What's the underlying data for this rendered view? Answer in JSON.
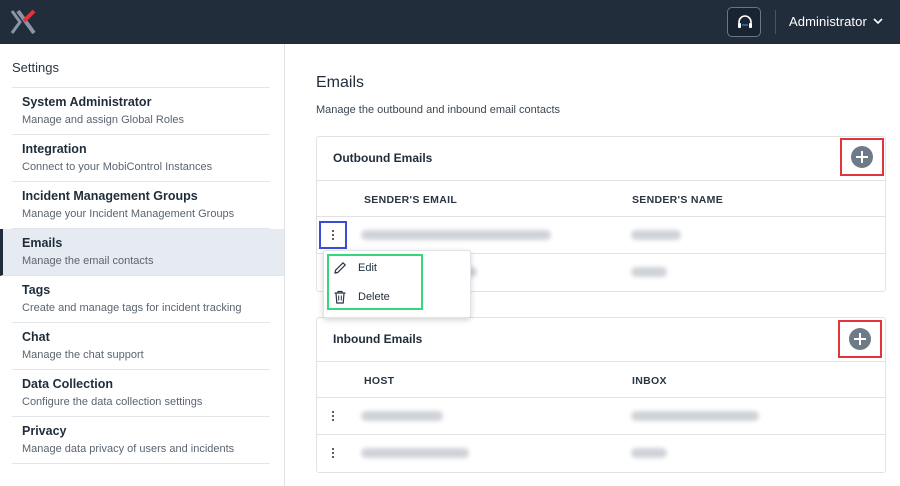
{
  "topbar": {
    "logo_icon": "brand-x-logo",
    "help_icon": "headset-icon",
    "user_label": "Administrator",
    "user_menu_icon": "chevron-down-icon"
  },
  "sidebar": {
    "title": "Settings",
    "items": [
      {
        "label": "System Administrator",
        "description": "Manage and assign Global Roles",
        "active": false
      },
      {
        "label": "Integration",
        "description": "Connect to your MobiControl Instances",
        "active": false
      },
      {
        "label": "Incident Management Groups",
        "description": "Manage your Incident Management Groups",
        "active": false
      },
      {
        "label": "Emails",
        "description": "Manage the email contacts",
        "active": true
      },
      {
        "label": "Tags",
        "description": "Create and manage tags for incident tracking",
        "active": false
      },
      {
        "label": "Chat",
        "description": "Manage the chat support",
        "active": false
      },
      {
        "label": "Data Collection",
        "description": "Configure the data collection settings",
        "active": false
      },
      {
        "label": "Privacy",
        "description": "Manage data privacy of users and incidents",
        "active": false
      }
    ]
  },
  "main": {
    "title": "Emails",
    "description": "Manage the outbound and inbound email contacts",
    "outbound": {
      "title": "Outbound Emails",
      "add_icon": "plus-circle-icon",
      "columns": [
        "SENDER'S EMAIL",
        "SENDER'S NAME"
      ],
      "rows": 2
    },
    "inbound": {
      "title": "Inbound Emails",
      "add_icon": "plus-circle-icon",
      "columns": [
        "HOST",
        "INBOX"
      ],
      "rows": 2
    },
    "context_menu": {
      "items": [
        {
          "label": "Edit",
          "icon": "pencil-icon"
        },
        {
          "label": "Delete",
          "icon": "trash-icon"
        }
      ]
    }
  },
  "colors": {
    "topbar": "#222d3b",
    "active_item_bg": "#e6ebf1",
    "add_highlight": "#e0353b",
    "kebab_highlight": "#3b4cd6",
    "menu_highlight": "#37d67a"
  }
}
